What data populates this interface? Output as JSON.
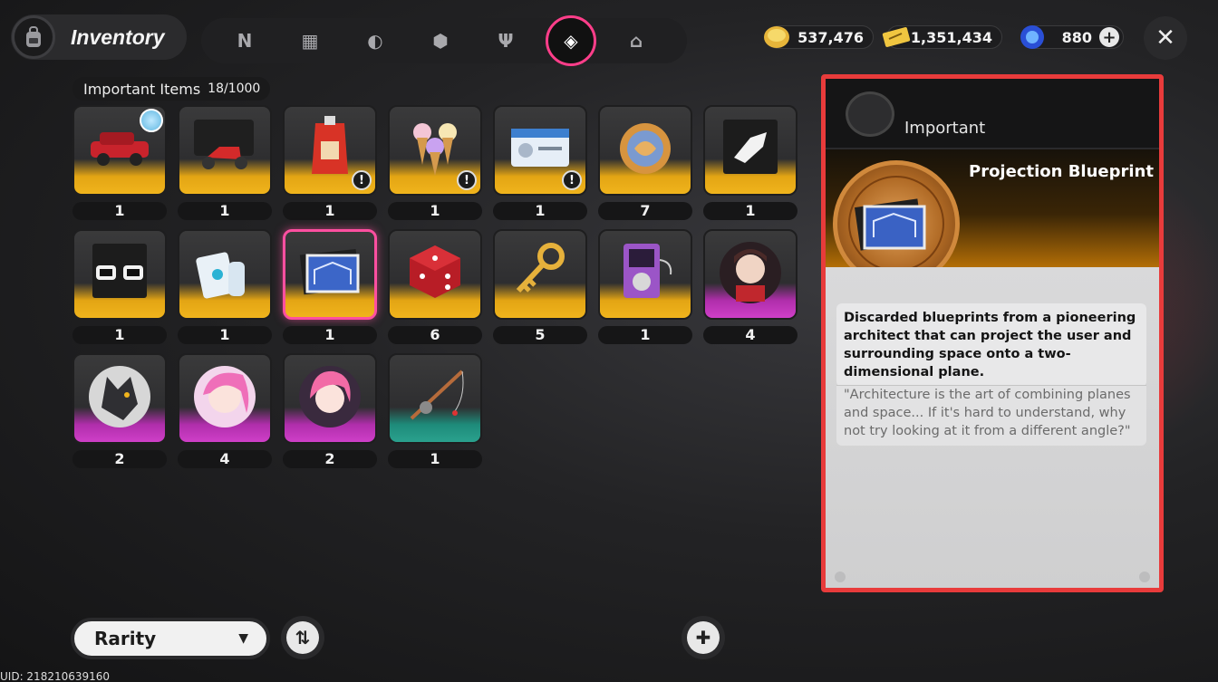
{
  "header": {
    "title": "Inventory",
    "tabs": [
      {
        "name": "tab-n-icon",
        "glyph": "N"
      },
      {
        "name": "tab-console-icon",
        "glyph": "▦"
      },
      {
        "name": "tab-disc-icon",
        "glyph": "◐"
      },
      {
        "name": "tab-cube-icon",
        "glyph": "⬢"
      },
      {
        "name": "tab-food-icon",
        "glyph": "🍴"
      },
      {
        "name": "tab-important-icon",
        "glyph": "◈",
        "active": true
      },
      {
        "name": "tab-home-icon",
        "glyph": "⌂"
      }
    ]
  },
  "currencies": {
    "dennies": "537,476",
    "tickets": "1,351,434",
    "polychrome": "880"
  },
  "section": {
    "label": "Important Items",
    "count": "18/1000"
  },
  "items": [
    {
      "name": "car",
      "qty": "1",
      "rarity": "gold",
      "new": true
    },
    {
      "name": "scooter",
      "qty": "1",
      "rarity": "gold"
    },
    {
      "name": "juice-pouch",
      "qty": "1",
      "rarity": "gold",
      "badge": true
    },
    {
      "name": "ice-cream",
      "qty": "1",
      "rarity": "gold",
      "badge": true
    },
    {
      "name": "id-card",
      "qty": "1",
      "rarity": "gold",
      "badge": true
    },
    {
      "name": "coin",
      "qty": "7",
      "rarity": "gold"
    },
    {
      "name": "glove-card",
      "qty": "1",
      "rarity": "gold"
    },
    {
      "name": "sunglasses",
      "qty": "1",
      "rarity": "gold"
    },
    {
      "name": "bottles",
      "qty": "1",
      "rarity": "gold"
    },
    {
      "name": "projection-blueprint",
      "qty": "1",
      "rarity": "gold",
      "selected": true
    },
    {
      "name": "dice",
      "qty": "6",
      "rarity": "gold"
    },
    {
      "name": "golden-key",
      "qty": "5",
      "rarity": "gold"
    },
    {
      "name": "music-player",
      "qty": "1",
      "rarity": "gold"
    },
    {
      "name": "portrait-man",
      "qty": "4",
      "rarity": "purple"
    },
    {
      "name": "portrait-wolf",
      "qty": "2",
      "rarity": "purple"
    },
    {
      "name": "portrait-pink-girl",
      "qty": "4",
      "rarity": "purple"
    },
    {
      "name": "portrait-pink-hair",
      "qty": "2",
      "rarity": "purple"
    },
    {
      "name": "fishing-rod",
      "qty": "1",
      "rarity": "teal"
    }
  ],
  "detail": {
    "category": "Important",
    "item_name": "Projection Blueprint",
    "description": "Discarded blueprints from a pioneering architect that can project the user and surrounding space onto a two-dimensional plane.",
    "flavor": "\"Architecture is the art of combining planes and space... If it's hard to understand, why not try looking at it from a different angle?\""
  },
  "footer": {
    "sort_label": "Rarity",
    "uid": "UID: 218210639160"
  },
  "colors": {
    "accent": "#ff3e8a",
    "gold": "#f0b41c",
    "purple": "#cf3fc8",
    "teal": "#2aa18d",
    "highlight": "#e83b3b"
  }
}
